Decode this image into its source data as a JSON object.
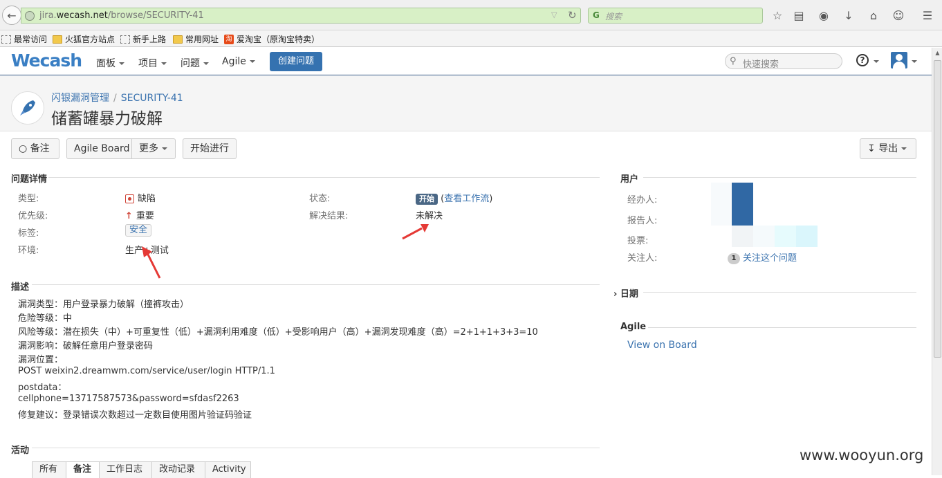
{
  "browser": {
    "url_prefix": "jira.",
    "url_domain": "wecash.net",
    "url_path": "/browse/SECURITY-41",
    "search_placeholder": "搜索",
    "bookmarks": [
      "最常访问",
      "火狐官方站点",
      "新手上路",
      "常用网址",
      "爱淘宝（原淘宝特卖）"
    ]
  },
  "header": {
    "logo": "Wecash",
    "nav": [
      "面板",
      "项目",
      "问题",
      "Agile"
    ],
    "create_label": "创建问题",
    "quick_search_placeholder": "快速搜索"
  },
  "issue": {
    "project": "闪银漏洞管理",
    "key": "SECURITY-41",
    "summary": "储蓄罐暴力破解"
  },
  "toolbar": {
    "comment": "备注",
    "agile_board": "Agile Board",
    "more": "更多",
    "start_progress": "开始进行",
    "export": "导出"
  },
  "details": {
    "title": "问题详情",
    "type_label": "类型:",
    "type_value": "缺陷",
    "priority_label": "优先级:",
    "priority_value": "重要",
    "labels_label": "标签:",
    "labels_value": "安全",
    "env_label": "环境:",
    "env_value": "生产+测试",
    "status_label": "状态:",
    "status_value": "开始",
    "view_workflow": "查看工作流",
    "resolution_label": "解决结果:",
    "resolution_value": "未解决"
  },
  "description": {
    "title": "描述",
    "lines": [
      "漏洞类型：用户登录暴力破解（撞裤攻击）",
      "危险等级：中",
      "风险等级：潜在损失（中）+可重复性（低）+漏洞利用难度（低）+受影响用户（高）+漏洞发现难度（高）=2+1+1+3+3=10",
      "漏洞影响：破解任意用户登录密码",
      "漏洞位置：",
      "POST weixin2.dreamwm.com/service/user/login HTTP/1.1",
      "postdata：",
      "cellphone=13717587573&password=sfdasf2263",
      "修复建议：登录错误次数超过一定数目使用图片验证码验证"
    ]
  },
  "activity": {
    "title": "活动",
    "tabs": [
      "所有",
      "备注",
      "工作日志",
      "改动记录",
      "Activity"
    ]
  },
  "people": {
    "title": "用户",
    "assignee_label": "经办人:",
    "reporter_label": "报告人:",
    "votes_label": "投票:",
    "watchers_label": "关注人:",
    "watch_count": "1",
    "watch_link": "关注这个问题"
  },
  "dates": {
    "title": "日期"
  },
  "agile": {
    "title": "Agile",
    "view_on_board": "View on Board"
  },
  "watermark": "www.wooyun.org",
  "colors": {
    "brand": "#3572b0",
    "link": "#3b73af",
    "status_lozenge": "#4a6785",
    "arrow": "#e53935"
  }
}
